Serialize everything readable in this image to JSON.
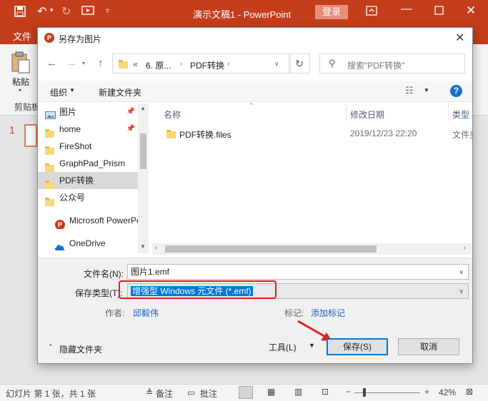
{
  "window": {
    "title": "演示文稿1  -  PowerPoint",
    "login_label": "登录"
  },
  "ribbon": {
    "file_tab": "文件",
    "paste_label": "粘贴",
    "clipboard_label": "剪贴板"
  },
  "slides": {
    "number": "1"
  },
  "status": {
    "slide_info": "幻灯片 第 1 张，共 1 张",
    "notes_label": "备注",
    "comments_label": "批注",
    "zoom": "42%"
  },
  "dialog": {
    "title": "另存为图片",
    "address": {
      "overflow": "«",
      "crumbs": [
        "6. 原...",
        "PDF转换"
      ]
    },
    "search_placeholder": "搜索\"PDF转换\"",
    "toolbar": {
      "organize": "组织",
      "new_folder": "新建文件夹"
    },
    "tree": [
      {
        "label": "图片",
        "icon": "picture-icon",
        "pinned": true
      },
      {
        "label": "home",
        "icon": "folder-icon",
        "pinned": true
      },
      {
        "label": "FireShot",
        "icon": "folder-icon",
        "pinned": false
      },
      {
        "label": "GraphPad_Prism",
        "icon": "folder-icon",
        "pinned": false
      },
      {
        "label": "PDF转换",
        "icon": "folder-icon",
        "pinned": false,
        "selected": true
      },
      {
        "label": "公众号",
        "icon": "folder-icon",
        "pinned": false
      },
      {
        "label": "Microsoft PowerPoint",
        "icon": "powerpoint-icon",
        "pinned": false
      },
      {
        "label": "OneDrive",
        "icon": "cloud-icon",
        "pinned": false
      }
    ],
    "columns": {
      "name": "名称",
      "modified": "修改日期",
      "type": "类型"
    },
    "files": [
      {
        "name": "PDF转换.files",
        "modified": "2019/12/23 22:20",
        "type": "文件夹"
      }
    ],
    "filename_label": "文件名(N):",
    "filename_value": "图片1.emf",
    "savetype_label": "保存类型(T):",
    "savetype_value": "增强型 Windows 元文件 (*.emf)",
    "author_label": "作者:",
    "author_value": "邱毅伟",
    "tags_label": "标记:",
    "tags_value": "添加标记",
    "hide_folders": "隐藏文件夹",
    "tools": "工具(L)",
    "save": "保存(S)",
    "cancel": "取消"
  },
  "colors": {
    "accent": "#c43e1c",
    "highlight": "#e02020",
    "selection": "#0078d7"
  }
}
